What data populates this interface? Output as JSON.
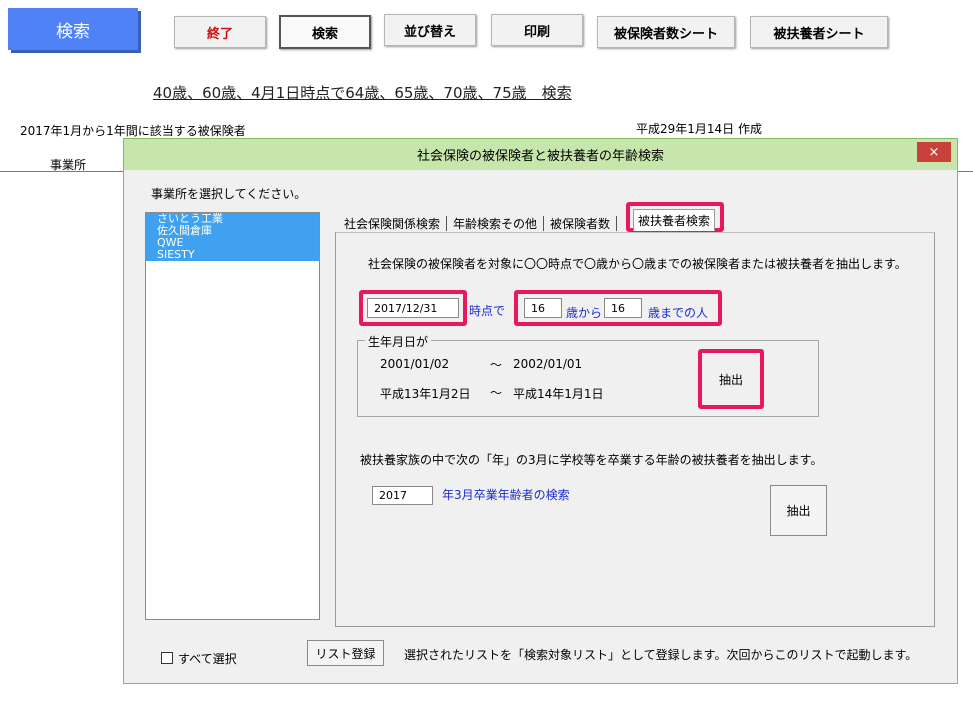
{
  "sheet": {
    "main_button": "検索",
    "buttons": [
      {
        "label": "終了",
        "color": "#d01010"
      },
      {
        "label": "検索"
      },
      {
        "label": "並び替え"
      },
      {
        "label": "印刷"
      },
      {
        "label": "被保険者数シート"
      },
      {
        "label": "被扶養者シート"
      }
    ],
    "link_title": "40歳、60歳、4月1日時点で64歳、65歳、70歳、75歳　検索",
    "period_text": "2017年1月から1年間に該当する被保険者",
    "date_text": "平成29年1月14日 作成",
    "office_label": "事業所"
  },
  "dialog": {
    "title": "社会保険の被保険者と被扶養者の年齢検索",
    "close": "×",
    "select_prompt": "事業所を選択してください。",
    "offices": [
      "さいとう工業",
      "佐久間倉庫",
      "QWE",
      "SIESTY"
    ],
    "tabs": [
      "社会保険関係検索",
      "年齢検索その他",
      "被保険者数",
      "被扶養者検索"
    ],
    "description": "社会保険の被保険者を対象に〇〇時点で〇歳から〇歳までの被保険者または被扶養者を抽出します。",
    "base_date": "2017/12/31",
    "at_label": "時点で",
    "age_from": "16",
    "from_label": "歳から",
    "age_to": "16",
    "to_label": "歳までの人",
    "birth_group": {
      "label": "生年月日が",
      "from_ad": "2001/01/02",
      "to_ad": "2002/01/01",
      "from_jp": "平成13年1月2日",
      "to_jp": "平成14年1月1日",
      "tilde": "～"
    },
    "extract_label": "抽出",
    "grad_description": "被扶養家族の中で次の「年」の3月に学校等を卒業する年齢の被扶養者を抽出します。",
    "grad_year": "2017",
    "grad_label": "年3月卒業年齢者の検索",
    "select_all_label": "すべて選択",
    "list_register_label": "リスト登録",
    "register_description": "選択されたリストを「検索対象リスト」として登録します。次回からこのリストで起動します。"
  },
  "colors": {
    "highlight": "#e8185e",
    "title_bar": "#c7e6ac",
    "list_selection": "#3fa1f0",
    "main_button": "#4f81f7"
  }
}
